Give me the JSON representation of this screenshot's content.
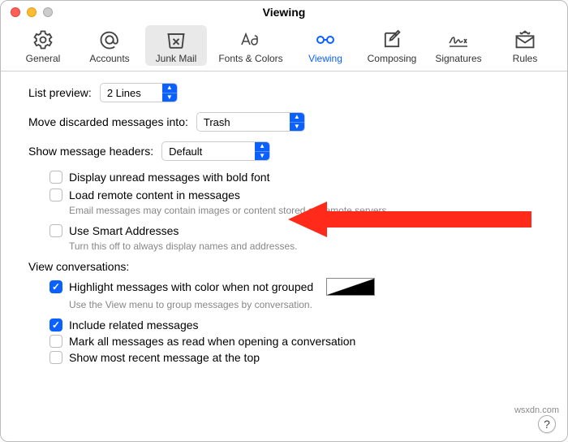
{
  "window": {
    "title": "Viewing"
  },
  "toolbar": {
    "items": [
      {
        "id": "general",
        "label": "General"
      },
      {
        "id": "accounts",
        "label": "Accounts"
      },
      {
        "id": "junk",
        "label": "Junk Mail"
      },
      {
        "id": "fonts",
        "label": "Fonts & Colors"
      },
      {
        "id": "viewing",
        "label": "Viewing"
      },
      {
        "id": "composing",
        "label": "Composing"
      },
      {
        "id": "signatures",
        "label": "Signatures"
      },
      {
        "id": "rules",
        "label": "Rules"
      }
    ],
    "activeBg": "junk",
    "selected": "viewing"
  },
  "form": {
    "listPreview": {
      "label": "List preview:",
      "value": "2 Lines"
    },
    "moveDiscarded": {
      "label": "Move discarded messages into:",
      "value": "Trash"
    },
    "showHeaders": {
      "label": "Show message headers:",
      "value": "Default"
    },
    "displayUnread": {
      "checked": false,
      "label": "Display unread messages with bold font"
    },
    "loadRemote": {
      "checked": false,
      "label": "Load remote content in messages",
      "desc": "Email messages may contain images or content stored on remote servers."
    },
    "smartAddresses": {
      "checked": false,
      "label": "Use Smart Addresses",
      "desc": "Turn this off to always display names and addresses."
    },
    "conversationsHeading": "View conversations:",
    "highlight": {
      "checked": true,
      "label": "Highlight messages with color when not grouped",
      "desc": "Use the View menu to group messages by conversation."
    },
    "includeRelated": {
      "checked": true,
      "label": "Include related messages"
    },
    "markAllRead": {
      "checked": false,
      "label": "Mark all messages as read when opening a conversation"
    },
    "showRecentTop": {
      "checked": false,
      "label": "Show most recent message at the top"
    }
  },
  "annotation": {
    "color": "#ff2a1a"
  },
  "help": {
    "label": "?"
  },
  "watermark": "wsxdn.com"
}
